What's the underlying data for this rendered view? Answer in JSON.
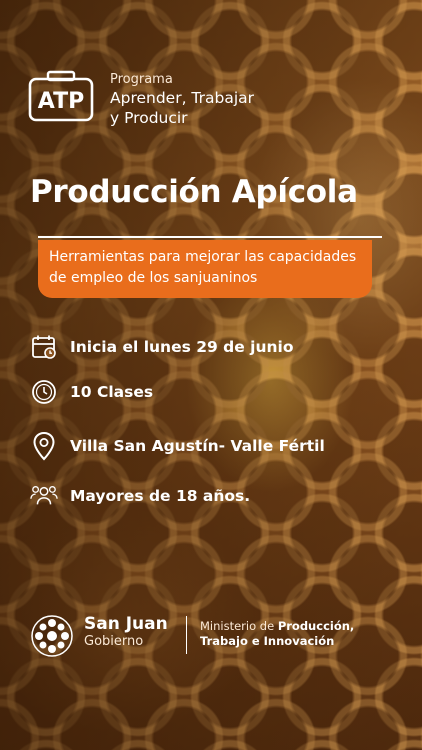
{
  "header": {
    "logo_text": "ATP",
    "program_label": "Programa",
    "program_name_line1": "Aprender, Trabajar",
    "program_name_line2": "y Producir"
  },
  "title": "Producción Apícola",
  "banner": {
    "line1": "Herramientas para mejorar las capacidades",
    "line2": "de empleo de los sanjuaninos"
  },
  "details": [
    {
      "icon": "calendar-icon",
      "text": "Inicia el lunes 29 de junio"
    },
    {
      "icon": "clock-icon",
      "text": "10 Clases"
    },
    {
      "icon": "location-pin-icon",
      "text": "Villa San Agustín- Valle Fértil"
    },
    {
      "icon": "people-icon",
      "text": "Mayores de 18 años."
    }
  ],
  "footer": {
    "gov_name": "San Juan",
    "gov_sub": "Gobierno",
    "ministry_prefix": "Ministerio de",
    "ministry_name_1": "Producción,",
    "ministry_name_2": "Trabajo e Innovación"
  },
  "colors": {
    "accent": "#e96d1c",
    "text": "#ffffff"
  }
}
